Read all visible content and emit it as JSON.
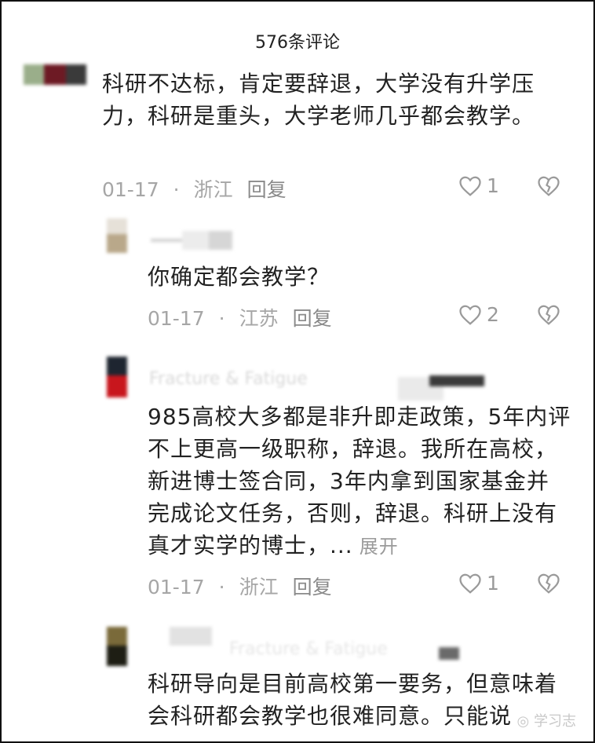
{
  "header": {
    "title": "576条评论"
  },
  "comments": [
    {
      "text": "科研不达标，肯定要辞退，大学没有升学压力，科研是重头，大学老师几乎都会教学。",
      "date": "01-17",
      "location": "浙江",
      "reply": "回复",
      "likes": "1"
    },
    {
      "text": "你确定都会教学？",
      "date": "01-17",
      "location": "江苏",
      "reply": "回复",
      "likes": "2"
    },
    {
      "username": "Fracture & Fatigue",
      "text": "985高校大多都是非升即走政策，5年内评不上更高一级职称，辞退。我所在高校，新进博士签合同，3年内拿到国家基金并完成论文任务，否则，辞退。科研上没有真才实学的博士，...",
      "more": "展开",
      "date": "01-17",
      "location": "浙江",
      "reply": "回复",
      "likes": "1"
    },
    {
      "username": "Fracture & Fatigue",
      "text": "科研导向是目前高校第一要务，但意味着会科研都会教学也很难同意。只能说"
    }
  ],
  "watermark": "学习志",
  "colors": {
    "text": "#222222",
    "meta": "#a6a6a6",
    "like_icon": "#9a9a9a"
  }
}
